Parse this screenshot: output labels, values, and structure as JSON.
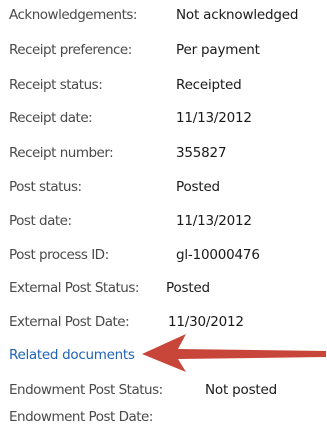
{
  "fields": [
    {
      "label": "Acknowledgements:",
      "value": "Not acknowledged"
    },
    {
      "label": "Receipt preference:",
      "value": "Per payment"
    },
    {
      "label": "Receipt status:",
      "value": "Receipted"
    },
    {
      "label": "Receipt date:",
      "value": "11/13/2012"
    },
    {
      "label": "Receipt number:",
      "value": "355827"
    },
    {
      "label": "Post status:",
      "value": "Posted"
    },
    {
      "label": "Post date:",
      "value": "11/13/2012"
    },
    {
      "label": "Post process ID:",
      "value": "gl-10000476"
    },
    {
      "label": "External Post Status:",
      "value": "Posted"
    },
    {
      "label": "External Post Date:",
      "value": "11/30/2012"
    }
  ],
  "related_documents_link": "Related documents",
  "endowment": [
    {
      "label": "Endowment Post Status:",
      "value": "Not posted"
    },
    {
      "label": "Endowment Post Date:",
      "value": ""
    }
  ],
  "colors": {
    "link": "#1f63b5",
    "arrow": "#c8453a",
    "label_text": "#4a4a4a",
    "value_text": "#1a1a1a"
  },
  "icons": {
    "annotation_arrow": "arrow-left-icon"
  }
}
